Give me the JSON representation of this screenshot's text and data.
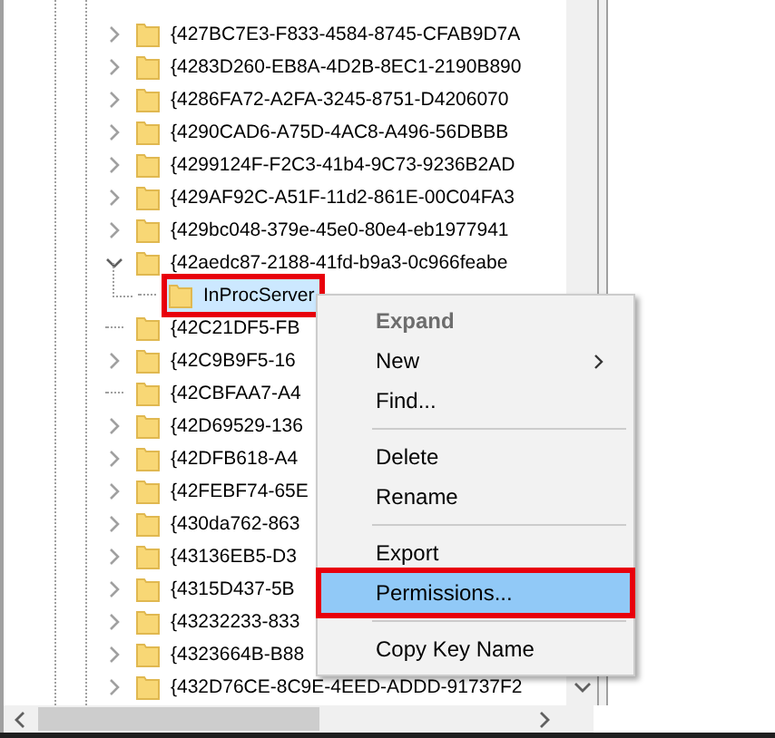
{
  "tree": [
    {
      "label": "{427BC7E3-F833-4584-8745-CFAB9D7A",
      "expanded": false,
      "selected": false
    },
    {
      "label": "{4283D260-EB8A-4D2B-8EC1-2190B890",
      "expanded": false,
      "selected": false
    },
    {
      "label": "{4286FA72-A2FA-3245-8751-D4206070",
      "expanded": false,
      "selected": false
    },
    {
      "label": "{4290CAD6-A75D-4AC8-A496-56DBBB",
      "expanded": false,
      "selected": false
    },
    {
      "label": "{4299124F-F2C3-41b4-9C73-9236B2AD",
      "expanded": false,
      "selected": false
    },
    {
      "label": "{429AF92C-A51F-11d2-861E-00C04FA3",
      "expanded": false,
      "selected": false
    },
    {
      "label": "{429bc048-379e-45e0-80e4-eb1977941",
      "expanded": false,
      "selected": false
    },
    {
      "label": "{42aedc87-2188-41fd-b9a3-0c966feabe",
      "expanded": true,
      "selected": false,
      "children": [
        {
          "label": "InProcServer",
          "selected": true,
          "annotated": true
        }
      ]
    },
    {
      "label": "{42C21DF5-FB",
      "selected": false
    },
    {
      "label": "{42C9B9F5-16",
      "expanded": false,
      "selected": false
    },
    {
      "label": "{42CBFAA7-A4",
      "selected": false
    },
    {
      "label": "{42D69529-136",
      "expanded": false,
      "selected": false
    },
    {
      "label": "{42DFB618-A4",
      "expanded": false,
      "selected": false
    },
    {
      "label": "{42FEBF74-65E",
      "expanded": false,
      "selected": false
    },
    {
      "label": "{430da762-863",
      "expanded": false,
      "selected": false
    },
    {
      "label": "{43136EB5-D3",
      "expanded": false,
      "selected": false
    },
    {
      "label": "{4315D437-5B",
      "expanded": false,
      "selected": false
    },
    {
      "label": "{43232233-833",
      "expanded": false,
      "selected": false
    },
    {
      "label": "{4323664B-B88",
      "expanded": false,
      "selected": false
    },
    {
      "label": "{432D76CE-8C9E-4EED-ADDD-91737F2",
      "expanded": false,
      "selected": false
    }
  ],
  "context_menu": [
    {
      "kind": "item",
      "label": "Expand",
      "default": true,
      "disabled": true,
      "submenu": false,
      "selected": false,
      "annotated": false
    },
    {
      "kind": "item",
      "label": "New",
      "default": false,
      "disabled": false,
      "submenu": true,
      "selected": false,
      "annotated": false
    },
    {
      "kind": "item",
      "label": "Find...",
      "default": false,
      "disabled": false,
      "submenu": false,
      "selected": false,
      "annotated": false
    },
    {
      "kind": "separator"
    },
    {
      "kind": "item",
      "label": "Delete",
      "default": false,
      "disabled": false,
      "submenu": false,
      "selected": false,
      "annotated": false
    },
    {
      "kind": "item",
      "label": "Rename",
      "default": false,
      "disabled": false,
      "submenu": false,
      "selected": false,
      "annotated": false
    },
    {
      "kind": "separator"
    },
    {
      "kind": "item",
      "label": "Export",
      "default": false,
      "disabled": false,
      "submenu": false,
      "selected": false,
      "annotated": false
    },
    {
      "kind": "item",
      "label": "Permissions...",
      "default": false,
      "disabled": false,
      "submenu": false,
      "selected": true,
      "annotated": true
    },
    {
      "kind": "separator"
    },
    {
      "kind": "item",
      "label": "Copy Key Name",
      "default": false,
      "disabled": false,
      "submenu": false,
      "selected": false,
      "annotated": false
    }
  ]
}
